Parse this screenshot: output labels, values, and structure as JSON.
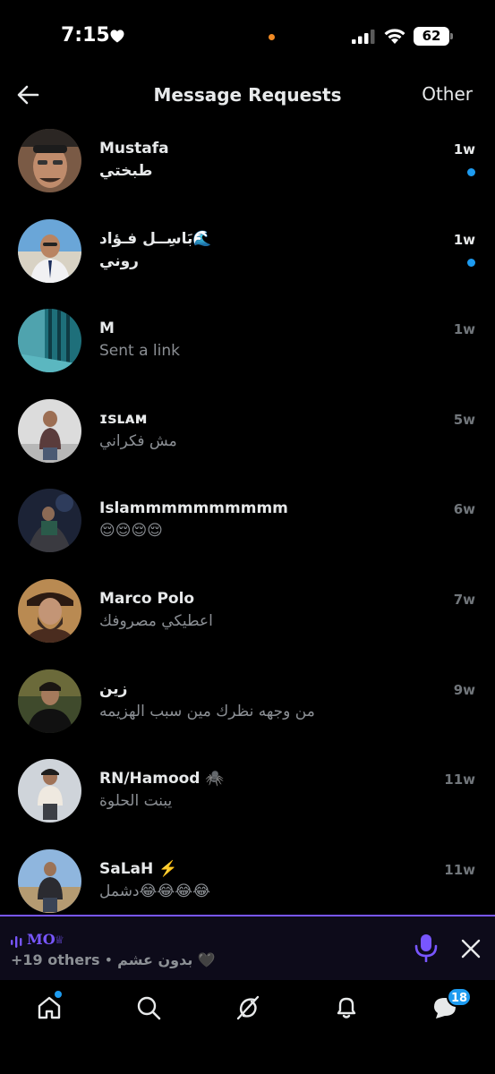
{
  "status_bar": {
    "time": "7:15",
    "battery": "62",
    "heart_icon": "heart-icon",
    "recording_dot_color": "#f08a24"
  },
  "header": {
    "title": "Message Requests",
    "other_label": "Other",
    "back_icon": "back-arrow-icon"
  },
  "colors": {
    "accent": "#1d9bf0",
    "spaces_purple": "#7856ff"
  },
  "requests": [
    {
      "name": "Mustafa",
      "preview": "طبختي",
      "time": "1w",
      "unread": true
    },
    {
      "name": "بَاسِــل فـؤاد🌊",
      "preview": "روني",
      "time": "1w",
      "unread": true
    },
    {
      "name": "M",
      "preview": "Sent a link",
      "time": "1w",
      "unread": false
    },
    {
      "name": "ɪsʟᴀᴍ",
      "preview": "مش فكراني",
      "time": "5w",
      "unread": false
    },
    {
      "name": "Islammmmmmmmmm",
      "preview": "😌😌😌😌",
      "time": "6w",
      "unread": false
    },
    {
      "name": "Marco Polo",
      "preview": "اعطيكي مصروفك",
      "time": "7w",
      "unread": false
    },
    {
      "name": "زين",
      "preview": "من وجهه نظرك مين سبب الهزيمه",
      "time": "9w",
      "unread": false
    },
    {
      "name": "RN/Hamood 🕷️",
      "preview": "يبنت الحلوة",
      "time": "11w",
      "unread": false
    },
    {
      "name": "SaLaH ⚡️",
      "preview": "دشمل😂😂😂😂",
      "time": "11w",
      "unread": false
    }
  ],
  "spaces": {
    "host": "MO",
    "crown": "♕",
    "others": "+19 others",
    "separator": " • ",
    "title": "بدون عشم 🖤"
  },
  "tab_bar": {
    "tabs": [
      "home-icon",
      "search-icon",
      "grok-icon",
      "bell-icon",
      "messages-icon"
    ],
    "messages_badge": "18"
  }
}
